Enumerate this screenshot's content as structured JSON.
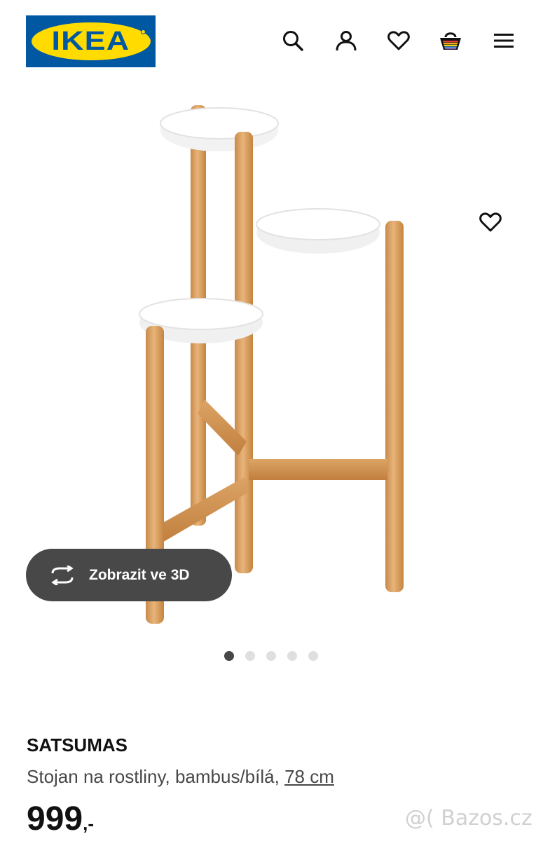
{
  "header": {
    "logo_text": "IKEA",
    "icons": [
      "search-icon",
      "profile-icon",
      "heart-icon",
      "cart-icon",
      "menu-icon"
    ]
  },
  "product_image": {
    "favourite_icon": "heart-icon",
    "view_3d_label": "Zobrazit ve 3D",
    "carousel_count": 5,
    "carousel_active_index": 0
  },
  "product": {
    "name": "SATSUMAS",
    "description": "Stojan na rostliny, bambus/bílá, ",
    "size": "78 cm",
    "price": "999",
    "price_suffix": ",-"
  },
  "watermark": "@( Bazos.cz",
  "colors": {
    "ikea_blue": "#0058a3",
    "ikea_yellow": "#ffdb00",
    "button_dark": "#484848",
    "dot_active": "#484848",
    "dot_inactive": "#dfdfdf"
  }
}
